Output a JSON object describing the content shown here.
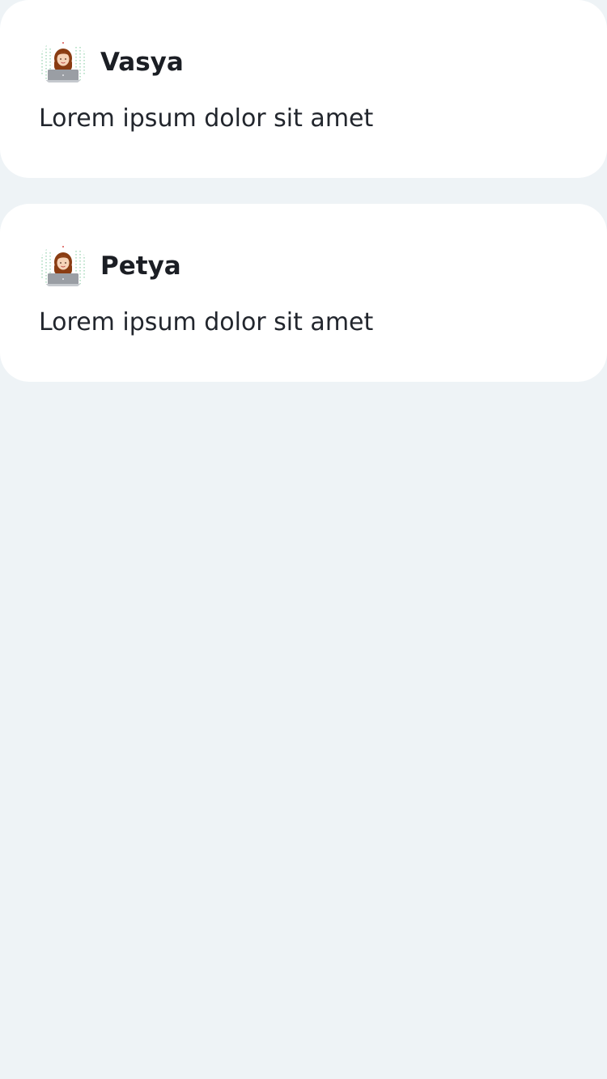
{
  "feed": {
    "posts": [
      {
        "author": "Vasya",
        "text": "Lorem ipsum dolor sit amet",
        "avatar_icon": "woman-with-laptop-avatar"
      },
      {
        "author": "Petya",
        "text": "Lorem ipsum dolor sit amet",
        "avatar_icon": "woman-with-laptop-avatar"
      }
    ]
  },
  "colors": {
    "background": "#eef3f6",
    "card": "#ffffff",
    "text": "#22262d",
    "hair": "#8a3c12",
    "laptop": "#9a9ea4",
    "code_rain": "#7bc79a"
  }
}
